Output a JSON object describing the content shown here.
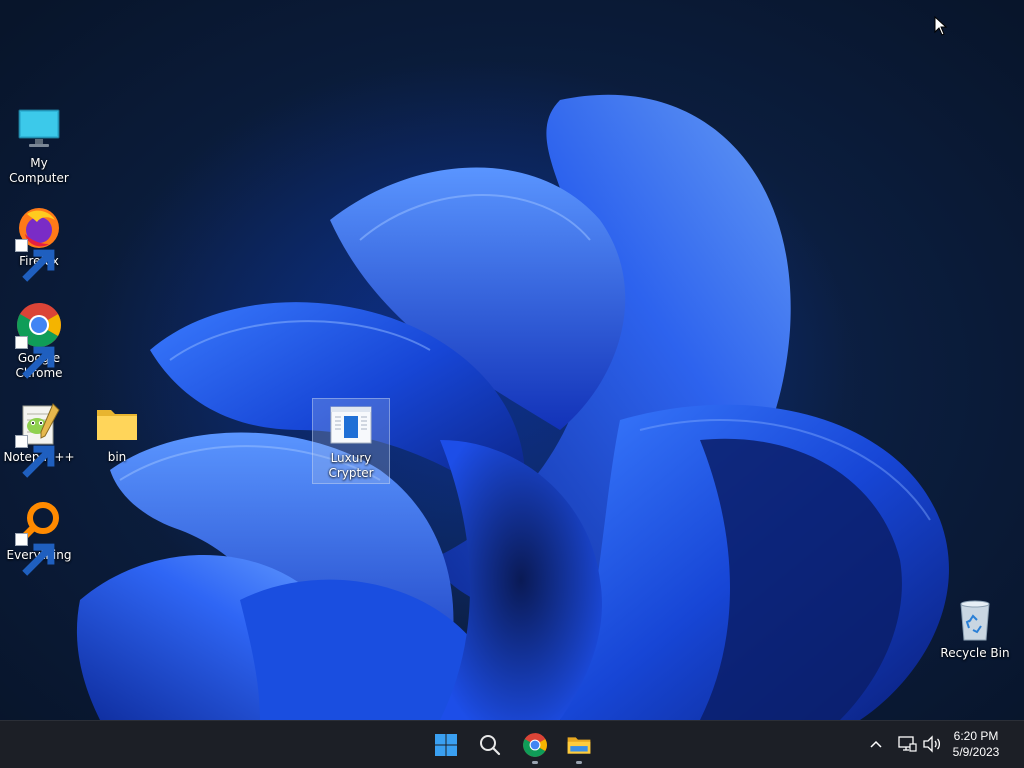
{
  "desktop": {
    "icons": [
      {
        "id": "my-computer",
        "label": "My Computer",
        "icon": "monitor-icon"
      },
      {
        "id": "firefox",
        "label": "Firefox",
        "icon": "firefox-icon",
        "shortcut": true
      },
      {
        "id": "google-chrome",
        "label": "Google Chrome",
        "icon": "chrome-icon",
        "shortcut": true
      },
      {
        "id": "notepadpp",
        "label": "Notepad++",
        "icon": "notepadpp-icon",
        "shortcut": true
      },
      {
        "id": "everything",
        "label": "Everything",
        "icon": "everything-icon",
        "shortcut": true
      },
      {
        "id": "bin-folder",
        "label": "bin",
        "icon": "folder-icon"
      },
      {
        "id": "luxury-crypter",
        "label": "Luxury Crypter",
        "icon": "application-icon",
        "selected": true
      },
      {
        "id": "recycle-bin",
        "label": "Recycle Bin",
        "icon": "recycle-bin-icon"
      }
    ]
  },
  "taskbar": {
    "pinned": [
      {
        "name": "start-button",
        "icon": "windows-logo-icon"
      },
      {
        "name": "search-button",
        "icon": "search-icon"
      },
      {
        "name": "chrome-taskbar-button",
        "icon": "chrome-icon",
        "running": true
      },
      {
        "name": "file-explorer-taskbar-button",
        "icon": "file-explorer-icon",
        "running": true
      }
    ],
    "tray": {
      "icons": [
        "chevron-up-icon",
        "network-icon",
        "volume-icon"
      ]
    },
    "clock": {
      "time": "6:20 PM",
      "date": "5/9/2023"
    }
  },
  "colors": {
    "taskbar": "#1c1f26",
    "wallpaper_accent": "#1a4ee0",
    "selection": "#aabee6"
  }
}
